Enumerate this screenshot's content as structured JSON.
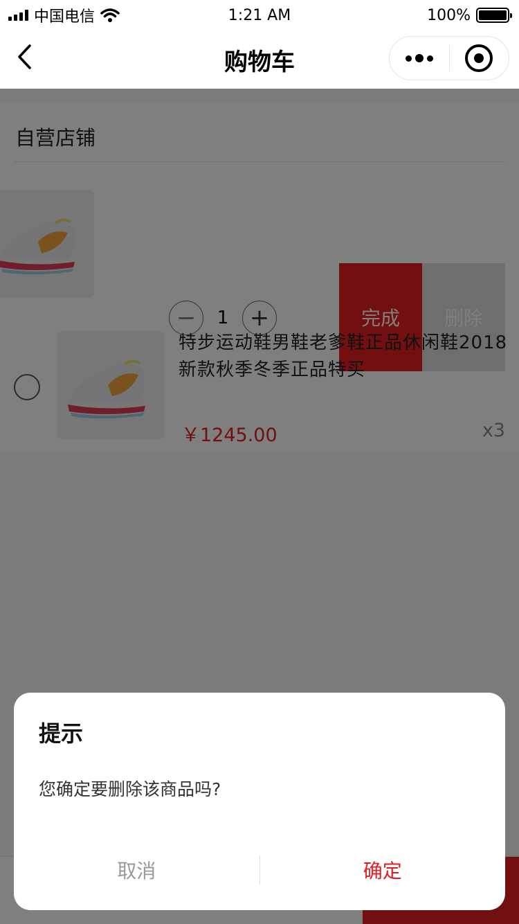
{
  "status_bar": {
    "carrier": "中国电信",
    "time": "1:21 AM",
    "battery": "100%"
  },
  "nav": {
    "title": "购物车"
  },
  "shop": {
    "name": "自营店铺"
  },
  "swiped_item": {
    "quantity": "1",
    "minus_label": "−",
    "plus_label": "+",
    "done_label": "完成",
    "delete_label": "删除"
  },
  "item": {
    "title": "特步运动鞋男鞋老爹鞋正品休闲鞋2018新款秋季冬季正品特买",
    "price": "￥1245.00",
    "quantity": "x3"
  },
  "dialog": {
    "title": "提示",
    "message": "您确定要删除该商品吗?",
    "cancel_label": "取消",
    "confirm_label": "确定"
  },
  "colors": {
    "accent": "#e31e23",
    "mask": "rgba(0,0,0,0.5)"
  },
  "icons": {
    "back": "chevron-left-icon",
    "more": "more-dots-icon",
    "capsule_close": "target-icon",
    "product": "sneaker-icon"
  }
}
